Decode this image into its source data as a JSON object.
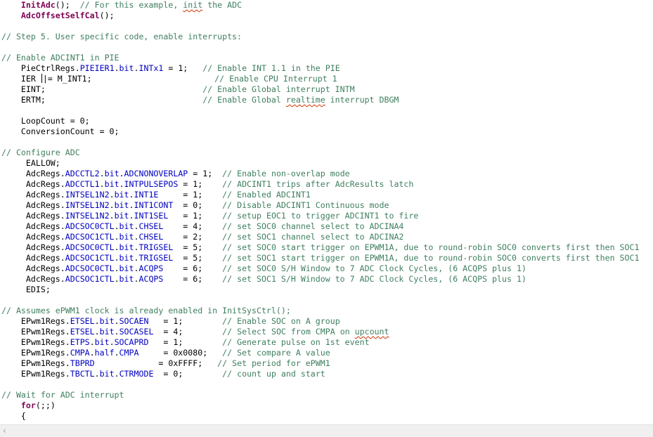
{
  "lines": [
    {
      "segs": [
        {
          "t": "    "
        },
        {
          "t": "InitAdc",
          "c": "fn"
        },
        {
          "t": "();  "
        },
        {
          "t": "// For this example, ",
          "c": "cm"
        },
        {
          "t": "init",
          "c": "cm sq"
        },
        {
          "t": " the ADC",
          "c": "cm"
        }
      ]
    },
    {
      "segs": [
        {
          "t": "    "
        },
        {
          "t": "AdcOffsetSelfCal",
          "c": "fn"
        },
        {
          "t": "();"
        }
      ]
    },
    {
      "segs": []
    },
    {
      "segs": [
        {
          "t": "// Step 5. User specific code, enable interrupts:",
          "c": "cm"
        }
      ]
    },
    {
      "segs": []
    },
    {
      "segs": [
        {
          "t": "// Enable ADCINT1 in PIE",
          "c": "cm"
        }
      ]
    },
    {
      "segs": [
        {
          "t": "    PieCtrlRegs."
        },
        {
          "t": "PIEIER1",
          "c": "fld"
        },
        {
          "t": "."
        },
        {
          "t": "bit",
          "c": "fld"
        },
        {
          "t": "."
        },
        {
          "t": "INTx1",
          "c": "fld"
        },
        {
          "t": " = 1;   "
        },
        {
          "t": "// Enable INT 1.1 in the PIE",
          "c": "cm"
        }
      ]
    },
    {
      "segs": [
        {
          "t": "    IER "
        },
        {
          "t": "",
          "cursor": true
        },
        {
          "t": "|= M_INT1;                         "
        },
        {
          "t": "// Enable CPU Interrupt 1",
          "c": "cm"
        }
      ]
    },
    {
      "segs": [
        {
          "t": "    EINT;                                "
        },
        {
          "t": "// Enable Global interrupt INTM",
          "c": "cm"
        }
      ]
    },
    {
      "segs": [
        {
          "t": "    ERTM;                                "
        },
        {
          "t": "// Enable Global ",
          "c": "cm"
        },
        {
          "t": "realtime",
          "c": "cm sq"
        },
        {
          "t": " interrupt DBGM",
          "c": "cm"
        }
      ]
    },
    {
      "segs": []
    },
    {
      "segs": [
        {
          "t": "    LoopCount = 0;"
        }
      ]
    },
    {
      "segs": [
        {
          "t": "    ConversionCount = 0;"
        }
      ]
    },
    {
      "segs": []
    },
    {
      "segs": [
        {
          "t": "// Configure ADC",
          "c": "cm"
        }
      ]
    },
    {
      "segs": [
        {
          "t": "     EALLOW;"
        }
      ]
    },
    {
      "segs": [
        {
          "t": "     AdcRegs."
        },
        {
          "t": "ADCCTL2",
          "c": "fld"
        },
        {
          "t": "."
        },
        {
          "t": "bit",
          "c": "fld"
        },
        {
          "t": "."
        },
        {
          "t": "ADCNONOVERLAP",
          "c": "fld"
        },
        {
          "t": " = 1;  "
        },
        {
          "t": "// Enable non-overlap mode",
          "c": "cm"
        }
      ]
    },
    {
      "segs": [
        {
          "t": "     AdcRegs."
        },
        {
          "t": "ADCCTL1",
          "c": "fld"
        },
        {
          "t": "."
        },
        {
          "t": "bit",
          "c": "fld"
        },
        {
          "t": "."
        },
        {
          "t": "INTPULSEPOS",
          "c": "fld"
        },
        {
          "t": " = 1;    "
        },
        {
          "t": "// ADCINT1 trips after AdcResults latch",
          "c": "cm"
        }
      ]
    },
    {
      "segs": [
        {
          "t": "     AdcRegs."
        },
        {
          "t": "INTSEL1N2",
          "c": "fld"
        },
        {
          "t": "."
        },
        {
          "t": "bit",
          "c": "fld"
        },
        {
          "t": "."
        },
        {
          "t": "INT1E",
          "c": "fld"
        },
        {
          "t": "     = 1;    "
        },
        {
          "t": "// Enabled ADCINT1",
          "c": "cm"
        }
      ]
    },
    {
      "segs": [
        {
          "t": "     AdcRegs."
        },
        {
          "t": "INTSEL1N2",
          "c": "fld"
        },
        {
          "t": "."
        },
        {
          "t": "bit",
          "c": "fld"
        },
        {
          "t": "."
        },
        {
          "t": "INT1CONT",
          "c": "fld"
        },
        {
          "t": "  = 0;    "
        },
        {
          "t": "// Disable ADCINT1 Continuous mode",
          "c": "cm"
        }
      ]
    },
    {
      "segs": [
        {
          "t": "     AdcRegs."
        },
        {
          "t": "INTSEL1N2",
          "c": "fld"
        },
        {
          "t": "."
        },
        {
          "t": "bit",
          "c": "fld"
        },
        {
          "t": "."
        },
        {
          "t": "INT1SEL",
          "c": "fld"
        },
        {
          "t": "   = 1;    "
        },
        {
          "t": "// setup EOC1 to trigger ADCINT1 to fire",
          "c": "cm"
        }
      ]
    },
    {
      "segs": [
        {
          "t": "     AdcRegs."
        },
        {
          "t": "ADCSOC0CTL",
          "c": "fld"
        },
        {
          "t": "."
        },
        {
          "t": "bit",
          "c": "fld"
        },
        {
          "t": "."
        },
        {
          "t": "CHSEL",
          "c": "fld"
        },
        {
          "t": "    = 4;    "
        },
        {
          "t": "// set SOC0 channel select to ADCINA4",
          "c": "cm"
        }
      ]
    },
    {
      "segs": [
        {
          "t": "     AdcRegs."
        },
        {
          "t": "ADCSOC1CTL",
          "c": "fld"
        },
        {
          "t": "."
        },
        {
          "t": "bit",
          "c": "fld"
        },
        {
          "t": "."
        },
        {
          "t": "CHSEL",
          "c": "fld"
        },
        {
          "t": "    = 2;    "
        },
        {
          "t": "// set SOC1 channel select to ADCINA2",
          "c": "cm"
        }
      ]
    },
    {
      "segs": [
        {
          "t": "     AdcRegs."
        },
        {
          "t": "ADCSOC0CTL",
          "c": "fld"
        },
        {
          "t": "."
        },
        {
          "t": "bit",
          "c": "fld"
        },
        {
          "t": "."
        },
        {
          "t": "TRIGSEL",
          "c": "fld"
        },
        {
          "t": "  = 5;    "
        },
        {
          "t": "// set SOC0 start trigger on EPWM1A, due to round-robin SOC0 converts first then SOC1",
          "c": "cm"
        }
      ]
    },
    {
      "segs": [
        {
          "t": "     AdcRegs."
        },
        {
          "t": "ADCSOC1CTL",
          "c": "fld"
        },
        {
          "t": "."
        },
        {
          "t": "bit",
          "c": "fld"
        },
        {
          "t": "."
        },
        {
          "t": "TRIGSEL",
          "c": "fld"
        },
        {
          "t": "  = 5;    "
        },
        {
          "t": "// set SOC1 start trigger on EPWM1A, due to round-robin SOC0 converts first then SOC1",
          "c": "cm"
        }
      ]
    },
    {
      "segs": [
        {
          "t": "     AdcRegs."
        },
        {
          "t": "ADCSOC0CTL",
          "c": "fld"
        },
        {
          "t": "."
        },
        {
          "t": "bit",
          "c": "fld"
        },
        {
          "t": "."
        },
        {
          "t": "ACQPS",
          "c": "fld"
        },
        {
          "t": "    = 6;    "
        },
        {
          "t": "// set SOC0 S/H Window to 7 ADC Clock Cycles, (6 ACQPS plus 1)",
          "c": "cm"
        }
      ]
    },
    {
      "segs": [
        {
          "t": "     AdcRegs."
        },
        {
          "t": "ADCSOC1CTL",
          "c": "fld"
        },
        {
          "t": "."
        },
        {
          "t": "bit",
          "c": "fld"
        },
        {
          "t": "."
        },
        {
          "t": "ACQPS",
          "c": "fld"
        },
        {
          "t": "    = 6;    "
        },
        {
          "t": "// set SOC1 S/H Window to 7 ADC Clock Cycles, (6 ACQPS plus 1)",
          "c": "cm"
        }
      ]
    },
    {
      "segs": [
        {
          "t": "     EDIS;"
        }
      ]
    },
    {
      "segs": []
    },
    {
      "segs": [
        {
          "t": "// Assumes ePWM1 clock is already enabled in InitSysCtrl();",
          "c": "cm"
        }
      ]
    },
    {
      "segs": [
        {
          "t": "    EPwm1Regs."
        },
        {
          "t": "ETSEL",
          "c": "fld"
        },
        {
          "t": "."
        },
        {
          "t": "bit",
          "c": "fld"
        },
        {
          "t": "."
        },
        {
          "t": "SOCAEN",
          "c": "fld"
        },
        {
          "t": "   = 1;        "
        },
        {
          "t": "// Enable SOC on A group",
          "c": "cm"
        }
      ]
    },
    {
      "segs": [
        {
          "t": "    EPwm1Regs."
        },
        {
          "t": "ETSEL",
          "c": "fld"
        },
        {
          "t": "."
        },
        {
          "t": "bit",
          "c": "fld"
        },
        {
          "t": "."
        },
        {
          "t": "SOCASEL",
          "c": "fld"
        },
        {
          "t": "  = 4;        "
        },
        {
          "t": "// Select SOC from CMPA on ",
          "c": "cm"
        },
        {
          "t": "upcount",
          "c": "cm sq"
        }
      ]
    },
    {
      "segs": [
        {
          "t": "    EPwm1Regs."
        },
        {
          "t": "ETPS",
          "c": "fld"
        },
        {
          "t": "."
        },
        {
          "t": "bit",
          "c": "fld"
        },
        {
          "t": "."
        },
        {
          "t": "SOCAPRD",
          "c": "fld"
        },
        {
          "t": "   = 1;        "
        },
        {
          "t": "// Generate pulse on 1st event",
          "c": "cm"
        }
      ]
    },
    {
      "segs": [
        {
          "t": "    EPwm1Regs."
        },
        {
          "t": "CMPA",
          "c": "fld"
        },
        {
          "t": "."
        },
        {
          "t": "half",
          "c": "fld"
        },
        {
          "t": "."
        },
        {
          "t": "CMPA",
          "c": "fld"
        },
        {
          "t": "     = 0x0080;   "
        },
        {
          "t": "// Set compare A value",
          "c": "cm"
        }
      ]
    },
    {
      "segs": [
        {
          "t": "    EPwm1Regs."
        },
        {
          "t": "TBPRD",
          "c": "fld"
        },
        {
          "t": "             = 0xFFFF;   "
        },
        {
          "t": "// Set period for ePWM1",
          "c": "cm"
        }
      ]
    },
    {
      "segs": [
        {
          "t": "    EPwm1Regs."
        },
        {
          "t": "TBCTL",
          "c": "fld"
        },
        {
          "t": "."
        },
        {
          "t": "bit",
          "c": "fld"
        },
        {
          "t": "."
        },
        {
          "t": "CTRMODE",
          "c": "fld"
        },
        {
          "t": "  = 0;        "
        },
        {
          "t": "// count up and start",
          "c": "cm"
        }
      ]
    },
    {
      "segs": []
    },
    {
      "segs": [
        {
          "t": "// Wait for ADC interrupt",
          "c": "cm"
        }
      ]
    },
    {
      "segs": [
        {
          "t": "    "
        },
        {
          "t": "for",
          "c": "kw"
        },
        {
          "t": "(;;)"
        }
      ]
    },
    {
      "segs": [
        {
          "t": "    {"
        }
      ]
    }
  ],
  "scrollbar": {
    "left_arrow_icon": "chevron-left-icon",
    "left_arrow_glyph": "‹"
  }
}
